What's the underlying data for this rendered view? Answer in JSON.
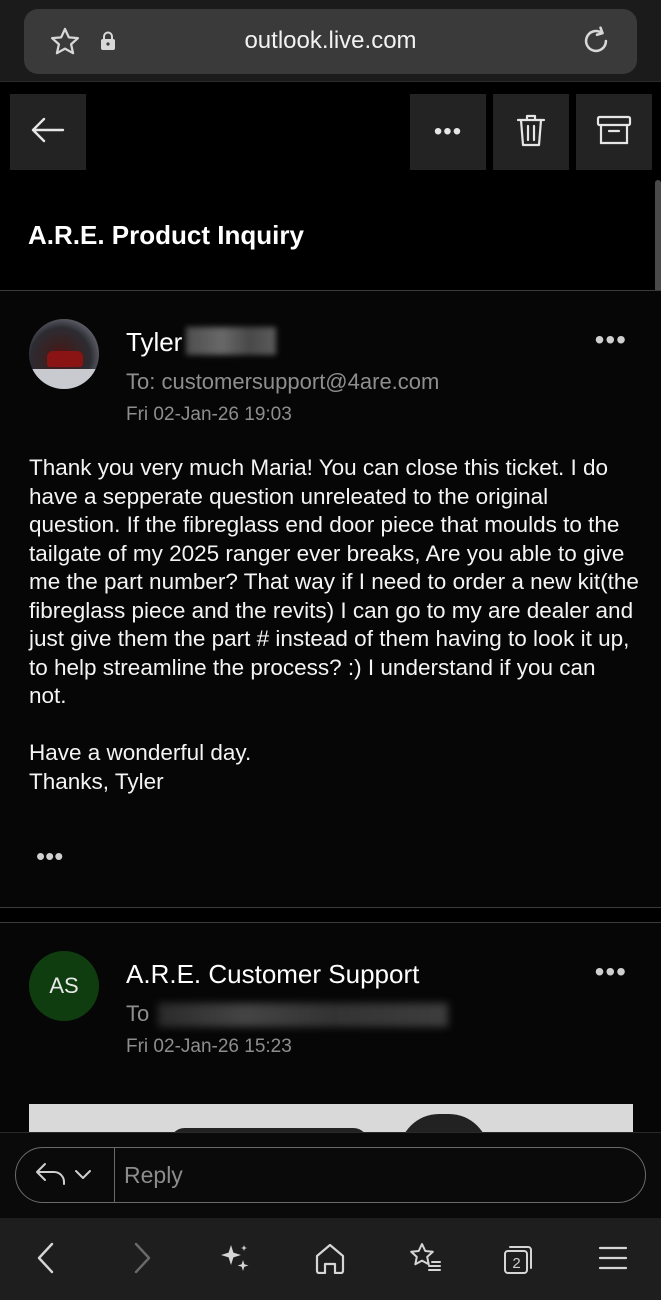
{
  "browser": {
    "url": "outlook.live.com"
  },
  "subject": "A.R.E. Product Inquiry",
  "messages": [
    {
      "sender": "Tyler",
      "to": "To: customersupport@4are.com",
      "date": "Fri 02-Jan-26 19:03",
      "body": [
        "Thank you very much Maria! You can close this ticket. I do have a sepperate question unreleated to the original question. If the fibreglass end door piece that moulds to the tailgate of my 2025 ranger ever breaks, Are you able to give me the part number? That way if I need to order a new kit(the fibreglass piece and the revits) I can go to my are dealer and just give them the part # instead of them having to look it up, to help streamline the process? :) I understand if you can not.",
        "Have a wonderful day.\nThanks, Tyler"
      ],
      "more_label": "•••",
      "quoted_label": "•••"
    },
    {
      "sender": "A.R.E. Customer Support",
      "avatar_initials": "AS",
      "avatar_color": "#0f3d0f",
      "to": "To",
      "date": "Fri 02-Jan-26 15:23",
      "more_label": "•••"
    }
  ],
  "reply": {
    "placeholder": "Reply"
  },
  "toolbar": {
    "more_label": "•••"
  },
  "bottom_nav": {
    "tab_count": "2"
  },
  "icons": [
    "star-icon",
    "lock-icon",
    "reload-icon",
    "back-arrow-icon",
    "more-icon",
    "trash-icon",
    "archive-icon",
    "reply-icon",
    "chevron-down-icon",
    "nav-back-icon",
    "nav-forward-icon",
    "sparkle-icon",
    "home-icon",
    "bookmarks-icon",
    "tabs-icon",
    "menu-icon"
  ]
}
